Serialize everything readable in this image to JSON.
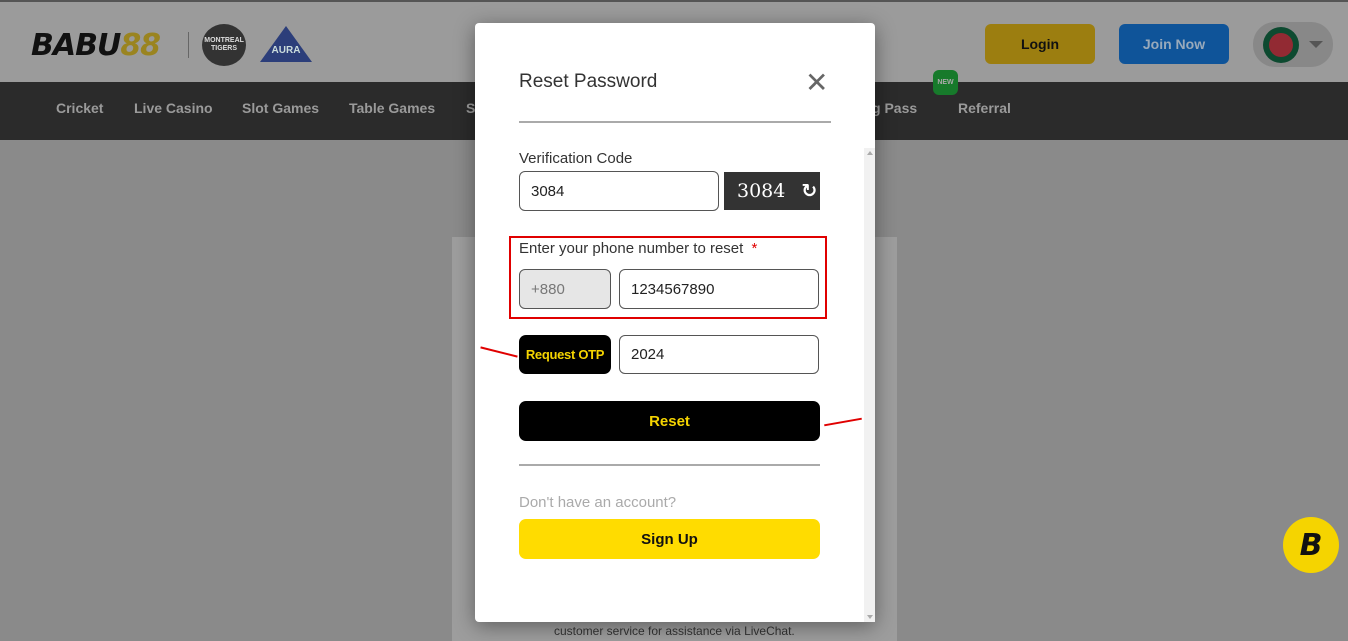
{
  "header": {
    "logo_main": "BABU",
    "logo_accent": "88",
    "partner1": "MONTREAL TIGERS",
    "partner2": "AURA",
    "login_label": "Login",
    "join_label": "Join Now",
    "language_flag": "bangladesh-flag-icon"
  },
  "nav": {
    "items": [
      {
        "label": "Cricket"
      },
      {
        "label": "Live Casino"
      },
      {
        "label": "Slot Games"
      },
      {
        "label": "Table Games"
      },
      {
        "label": "S"
      },
      {
        "label": "g Pass"
      },
      {
        "label": "Referral"
      }
    ],
    "new_badge": "NEW"
  },
  "background": {
    "text": "customer service for assistance via LiveChat."
  },
  "modal": {
    "title": "Reset Password",
    "verification_label": "Verification Code",
    "verification_value": "3084",
    "captcha_text": "3084",
    "phone_label": "Enter your phone number to reset",
    "required_mark": "*",
    "country_code": "+880",
    "phone_value": "1234567890",
    "request_otp_label": "Request OTP",
    "otp_value": "2024",
    "reset_label": "Reset",
    "no_account_text": "Don't have an account?",
    "signup_label": "Sign Up"
  },
  "colors": {
    "accent_yellow": "#ffdc00",
    "annotation_red": "#e00000"
  }
}
